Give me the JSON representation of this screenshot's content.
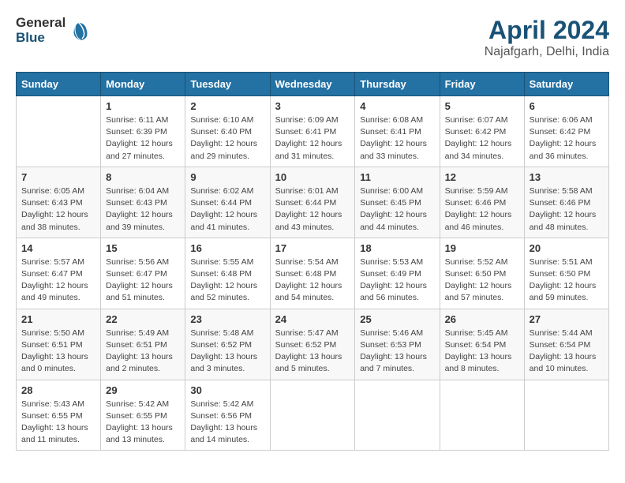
{
  "header": {
    "logo_general": "General",
    "logo_blue": "Blue",
    "month_title": "April 2024",
    "location": "Najafgarh, Delhi, India"
  },
  "days_of_week": [
    "Sunday",
    "Monday",
    "Tuesday",
    "Wednesday",
    "Thursday",
    "Friday",
    "Saturday"
  ],
  "weeks": [
    [
      {
        "day": "",
        "detail": ""
      },
      {
        "day": "1",
        "detail": "Sunrise: 6:11 AM\nSunset: 6:39 PM\nDaylight: 12 hours\nand 27 minutes."
      },
      {
        "day": "2",
        "detail": "Sunrise: 6:10 AM\nSunset: 6:40 PM\nDaylight: 12 hours\nand 29 minutes."
      },
      {
        "day": "3",
        "detail": "Sunrise: 6:09 AM\nSunset: 6:41 PM\nDaylight: 12 hours\nand 31 minutes."
      },
      {
        "day": "4",
        "detail": "Sunrise: 6:08 AM\nSunset: 6:41 PM\nDaylight: 12 hours\nand 33 minutes."
      },
      {
        "day": "5",
        "detail": "Sunrise: 6:07 AM\nSunset: 6:42 PM\nDaylight: 12 hours\nand 34 minutes."
      },
      {
        "day": "6",
        "detail": "Sunrise: 6:06 AM\nSunset: 6:42 PM\nDaylight: 12 hours\nand 36 minutes."
      }
    ],
    [
      {
        "day": "7",
        "detail": "Sunrise: 6:05 AM\nSunset: 6:43 PM\nDaylight: 12 hours\nand 38 minutes."
      },
      {
        "day": "8",
        "detail": "Sunrise: 6:04 AM\nSunset: 6:43 PM\nDaylight: 12 hours\nand 39 minutes."
      },
      {
        "day": "9",
        "detail": "Sunrise: 6:02 AM\nSunset: 6:44 PM\nDaylight: 12 hours\nand 41 minutes."
      },
      {
        "day": "10",
        "detail": "Sunrise: 6:01 AM\nSunset: 6:44 PM\nDaylight: 12 hours\nand 43 minutes."
      },
      {
        "day": "11",
        "detail": "Sunrise: 6:00 AM\nSunset: 6:45 PM\nDaylight: 12 hours\nand 44 minutes."
      },
      {
        "day": "12",
        "detail": "Sunrise: 5:59 AM\nSunset: 6:46 PM\nDaylight: 12 hours\nand 46 minutes."
      },
      {
        "day": "13",
        "detail": "Sunrise: 5:58 AM\nSunset: 6:46 PM\nDaylight: 12 hours\nand 48 minutes."
      }
    ],
    [
      {
        "day": "14",
        "detail": "Sunrise: 5:57 AM\nSunset: 6:47 PM\nDaylight: 12 hours\nand 49 minutes."
      },
      {
        "day": "15",
        "detail": "Sunrise: 5:56 AM\nSunset: 6:47 PM\nDaylight: 12 hours\nand 51 minutes."
      },
      {
        "day": "16",
        "detail": "Sunrise: 5:55 AM\nSunset: 6:48 PM\nDaylight: 12 hours\nand 52 minutes."
      },
      {
        "day": "17",
        "detail": "Sunrise: 5:54 AM\nSunset: 6:48 PM\nDaylight: 12 hours\nand 54 minutes."
      },
      {
        "day": "18",
        "detail": "Sunrise: 5:53 AM\nSunset: 6:49 PM\nDaylight: 12 hours\nand 56 minutes."
      },
      {
        "day": "19",
        "detail": "Sunrise: 5:52 AM\nSunset: 6:50 PM\nDaylight: 12 hours\nand 57 minutes."
      },
      {
        "day": "20",
        "detail": "Sunrise: 5:51 AM\nSunset: 6:50 PM\nDaylight: 12 hours\nand 59 minutes."
      }
    ],
    [
      {
        "day": "21",
        "detail": "Sunrise: 5:50 AM\nSunset: 6:51 PM\nDaylight: 13 hours\nand 0 minutes."
      },
      {
        "day": "22",
        "detail": "Sunrise: 5:49 AM\nSunset: 6:51 PM\nDaylight: 13 hours\nand 2 minutes."
      },
      {
        "day": "23",
        "detail": "Sunrise: 5:48 AM\nSunset: 6:52 PM\nDaylight: 13 hours\nand 3 minutes."
      },
      {
        "day": "24",
        "detail": "Sunrise: 5:47 AM\nSunset: 6:52 PM\nDaylight: 13 hours\nand 5 minutes."
      },
      {
        "day": "25",
        "detail": "Sunrise: 5:46 AM\nSunset: 6:53 PM\nDaylight: 13 hours\nand 7 minutes."
      },
      {
        "day": "26",
        "detail": "Sunrise: 5:45 AM\nSunset: 6:54 PM\nDaylight: 13 hours\nand 8 minutes."
      },
      {
        "day": "27",
        "detail": "Sunrise: 5:44 AM\nSunset: 6:54 PM\nDaylight: 13 hours\nand 10 minutes."
      }
    ],
    [
      {
        "day": "28",
        "detail": "Sunrise: 5:43 AM\nSunset: 6:55 PM\nDaylight: 13 hours\nand 11 minutes."
      },
      {
        "day": "29",
        "detail": "Sunrise: 5:42 AM\nSunset: 6:55 PM\nDaylight: 13 hours\nand 13 minutes."
      },
      {
        "day": "30",
        "detail": "Sunrise: 5:42 AM\nSunset: 6:56 PM\nDaylight: 13 hours\nand 14 minutes."
      },
      {
        "day": "",
        "detail": ""
      },
      {
        "day": "",
        "detail": ""
      },
      {
        "day": "",
        "detail": ""
      },
      {
        "day": "",
        "detail": ""
      }
    ]
  ]
}
